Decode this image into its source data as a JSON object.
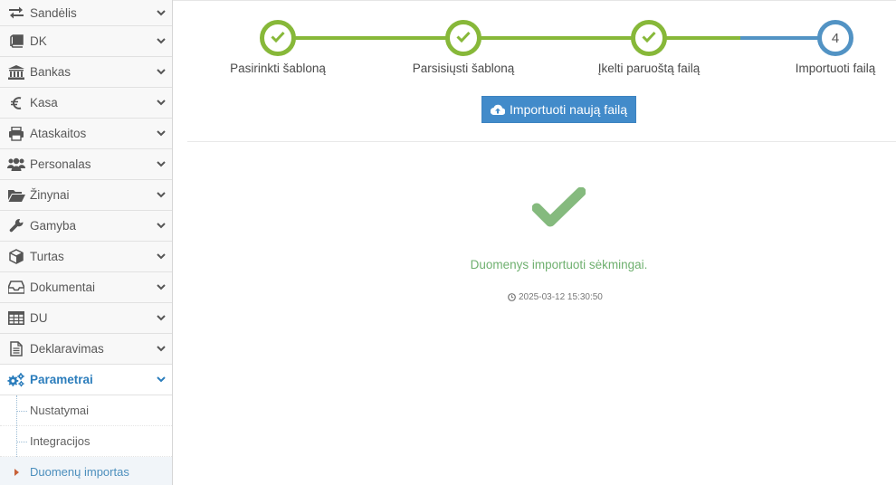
{
  "sidebar": {
    "items": [
      {
        "label": "Sandėlis",
        "icon": "exchange-icon"
      },
      {
        "label": "DK",
        "icon": "book-icon"
      },
      {
        "label": "Bankas",
        "icon": "bank-icon"
      },
      {
        "label": "Kasa",
        "icon": "euro-icon"
      },
      {
        "label": "Ataskaitos",
        "icon": "printer-icon"
      },
      {
        "label": "Personalas",
        "icon": "users-icon"
      },
      {
        "label": "Žinynai",
        "icon": "folder-open-icon"
      },
      {
        "label": "Gamyba",
        "icon": "wrench-icon"
      },
      {
        "label": "Turtas",
        "icon": "cube-icon"
      },
      {
        "label": "Dokumentai",
        "icon": "inbox-icon"
      },
      {
        "label": "DU",
        "icon": "table-icon"
      },
      {
        "label": "Deklaravimas",
        "icon": "document-icon"
      },
      {
        "label": "Parametrai",
        "icon": "cogs-icon"
      }
    ],
    "subitems": [
      {
        "label": "Nustatymai"
      },
      {
        "label": "Integracijos"
      },
      {
        "label": "Duomenų importas"
      }
    ]
  },
  "wizard": {
    "steps": [
      {
        "label": "Pasirinkti šabloną",
        "state": "complete"
      },
      {
        "label": "Parsisiųsti šabloną",
        "state": "complete"
      },
      {
        "label": "Įkelti paruoštą failą",
        "state": "complete"
      },
      {
        "label": "Importuoti failą",
        "state": "current",
        "number": "4"
      }
    ]
  },
  "actions": {
    "import_new_label": "Importuoti naują failą"
  },
  "result": {
    "message": "Duomenys importuoti sėkmingai.",
    "timestamp": "2025-03-12 15:30:50"
  },
  "colors": {
    "complete": "#87b839",
    "current": "#5293c4",
    "success_text": "#6fb06f",
    "check_icon": "#85ba7e",
    "button": "#428bca",
    "active_nav": "#2b7dbc"
  }
}
